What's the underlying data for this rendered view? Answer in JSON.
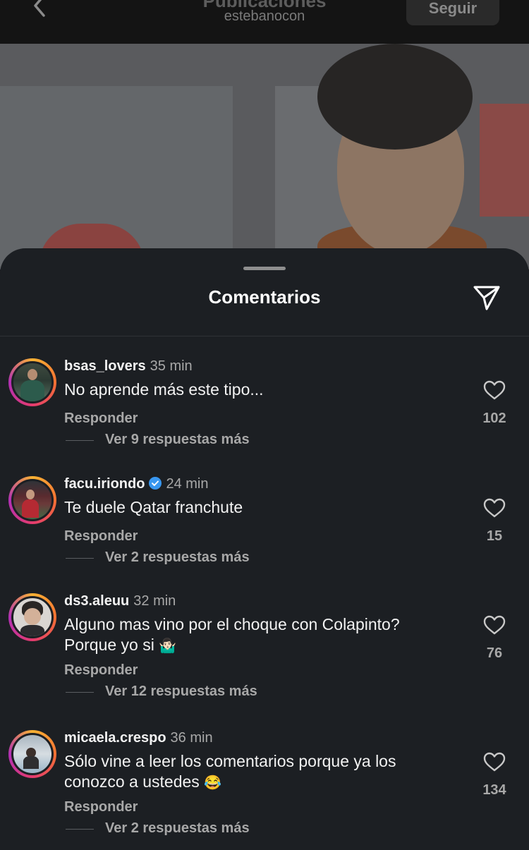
{
  "header": {
    "title": "Publicaciones",
    "username": "estebanocon",
    "follow_label": "Seguir",
    "back_icon": "chevron-left-icon"
  },
  "sheet": {
    "title": "Comentarios",
    "share_icon": "send-icon"
  },
  "colors": {
    "sheet_bg": "#1c1f23",
    "text_primary": "#f2f2f2",
    "text_secondary": "#a8a8a8",
    "verified": "#3897f0"
  },
  "comments": [
    {
      "username": "bsas_lovers",
      "time": "35 min",
      "verified": false,
      "text": "No aprende más este tipo...",
      "reply_label": "Responder",
      "more_replies": "Ver 9 respuestas más",
      "likes": "102"
    },
    {
      "username": "facu.iriondo",
      "time": "24 min",
      "verified": true,
      "text": "Te duele Qatar franchute",
      "reply_label": "Responder",
      "more_replies": "Ver 2 respuestas más",
      "likes": "15"
    },
    {
      "username": "ds3.aleuu",
      "time": "32 min",
      "verified": false,
      "text_line1": "Alguno mas vino por el choque con Colapinto?",
      "text_line2": "Porque yo si",
      "emoji": "🤷🏻‍♂️",
      "reply_label": "Responder",
      "more_replies": "Ver 12 respuestas más",
      "likes": "76"
    },
    {
      "username": "micaela.crespo",
      "time": "36 min",
      "verified": false,
      "text_line1": "Sólo vine a leer los comentarios porque ya los",
      "text_line2": "conozco a ustedes",
      "emoji": "😂",
      "reply_label": "Responder",
      "more_replies": "Ver 2 respuestas más",
      "likes": "134"
    }
  ]
}
